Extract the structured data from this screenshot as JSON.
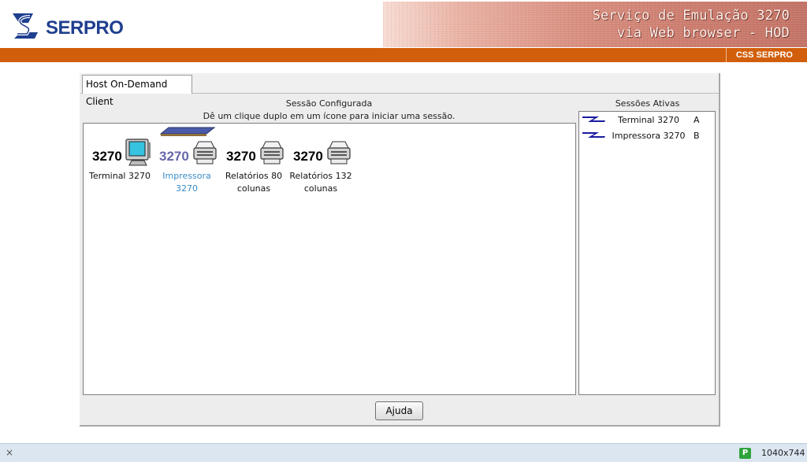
{
  "header": {
    "logo_text": "SERPRO",
    "banner_line1": "Serviço de Emulação 3270",
    "banner_line2": "via Web browser - HOD",
    "brand_badge": "CSS SERPRO"
  },
  "applet": {
    "tab_label": "Host On-Demand Client",
    "configured": {
      "title": "Sessão Configurada",
      "hint": "Dê um clique duplo em um ícone para iniciar uma sessão.",
      "sessions": [
        {
          "number": "3270",
          "label_line1": "Terminal 3270",
          "label_line2": "",
          "icon": "monitor-icon"
        },
        {
          "number": "3270",
          "label_line1": "Impressora",
          "label_line2": "3270",
          "icon": "printer-icon",
          "selected": true
        },
        {
          "number": "3270",
          "label_line1": "Relatórios 80",
          "label_line2": "colunas",
          "icon": "printer-icon"
        },
        {
          "number": "3270",
          "label_line1": "Relatórios 132",
          "label_line2": "colunas",
          "icon": "printer-icon"
        }
      ]
    },
    "active": {
      "title": "Sessões Ativas",
      "sessions": [
        {
          "name": "Terminal 3270",
          "letter": "A"
        },
        {
          "name": "Impressora 3270",
          "letter": "B"
        }
      ]
    },
    "help_button": "Ajuda"
  },
  "statusbar": {
    "close_glyph": "×",
    "badge": "P",
    "size": "1040x744"
  },
  "colors": {
    "orange_bar": "#d15e0a",
    "logo_blue": "#1f3f8f",
    "selected_label": "#3a8dc8"
  }
}
